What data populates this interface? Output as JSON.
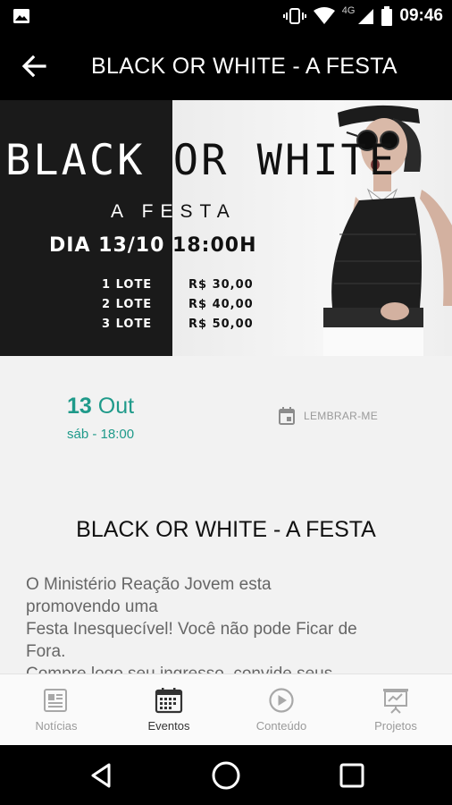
{
  "status_bar": {
    "time": "09:46",
    "network": "4G",
    "icons": [
      "image-icon",
      "vibrate-icon",
      "wifi-icon",
      "signal-icon",
      "battery-icon"
    ]
  },
  "app_bar": {
    "title": "BLACK OR WHITE - A FESTA",
    "back_icon": "arrow-back-icon"
  },
  "banner": {
    "title": "BLACK OR WHITE",
    "subtitle": "A FESTA",
    "date_line": "DIA 13/10 18:00H",
    "lotes": [
      {
        "name": "1 LOTE",
        "price": "R$ 30,00"
      },
      {
        "name": "2 LOTE",
        "price": "R$ 40,00"
      },
      {
        "name": "3 LOTE",
        "price": "R$ 50,00"
      }
    ]
  },
  "event": {
    "day": "13",
    "month": "Out",
    "weekday_time": "sáb - 18:00",
    "remind_label": "LEMBRAR-ME",
    "title": "BLACK OR WHITE - A FESTA",
    "description_lines": [
      "O Ministério Reação Jovem esta",
      "promovendo uma",
      "Festa Inesquecível! Você não pode Ficar de",
      "Fora.",
      "Compre logo seu ingresso, convide seus"
    ]
  },
  "bottom_nav": {
    "items": [
      {
        "label": "Notícias",
        "icon": "news-icon",
        "active": false
      },
      {
        "label": "Eventos",
        "icon": "calendar-icon",
        "active": true
      },
      {
        "label": "Conteúdo",
        "icon": "play-circle-icon",
        "active": false
      },
      {
        "label": "Projetos",
        "icon": "presentation-icon",
        "active": false
      }
    ]
  },
  "colors": {
    "accent": "#1f9a8a",
    "bar": "#000000",
    "background": "#f2f2f2"
  }
}
